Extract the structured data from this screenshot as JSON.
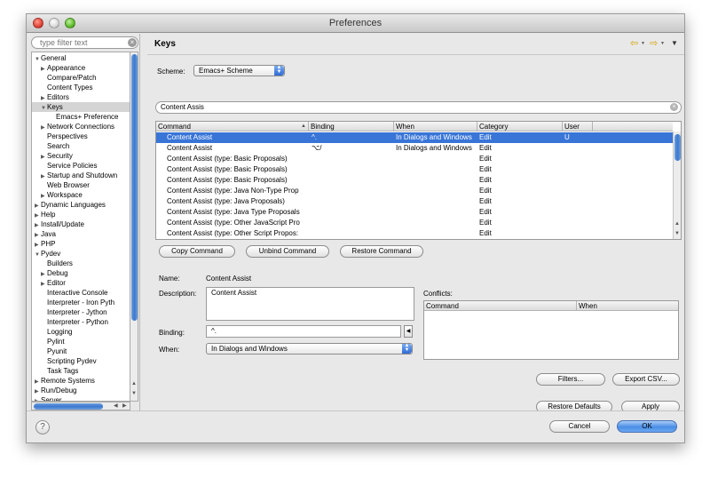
{
  "window": {
    "title": "Preferences"
  },
  "filter": {
    "placeholder": "type filter text"
  },
  "tree": [
    {
      "label": "General",
      "level": 0,
      "arrow": "open"
    },
    {
      "label": "Appearance",
      "level": 1,
      "arrow": "closed"
    },
    {
      "label": "Compare/Patch",
      "level": 1,
      "arrow": ""
    },
    {
      "label": "Content Types",
      "level": 1,
      "arrow": ""
    },
    {
      "label": "Editors",
      "level": 1,
      "arrow": "closed"
    },
    {
      "label": "Keys",
      "level": 1,
      "arrow": "open",
      "selected": true
    },
    {
      "label": "Emacs+ Preference",
      "level": 2,
      "arrow": ""
    },
    {
      "label": "Network Connections",
      "level": 1,
      "arrow": "closed"
    },
    {
      "label": "Perspectives",
      "level": 1,
      "arrow": ""
    },
    {
      "label": "Search",
      "level": 1,
      "arrow": ""
    },
    {
      "label": "Security",
      "level": 1,
      "arrow": "closed"
    },
    {
      "label": "Service Policies",
      "level": 1,
      "arrow": ""
    },
    {
      "label": "Startup and Shutdown",
      "level": 1,
      "arrow": "closed"
    },
    {
      "label": "Web Browser",
      "level": 1,
      "arrow": ""
    },
    {
      "label": "Workspace",
      "level": 1,
      "arrow": "closed"
    },
    {
      "label": "Dynamic Languages",
      "level": 0,
      "arrow": "closed"
    },
    {
      "label": "Help",
      "level": 0,
      "arrow": "closed"
    },
    {
      "label": "Install/Update",
      "level": 0,
      "arrow": "closed"
    },
    {
      "label": "Java",
      "level": 0,
      "arrow": "closed"
    },
    {
      "label": "PHP",
      "level": 0,
      "arrow": "closed"
    },
    {
      "label": "Pydev",
      "level": 0,
      "arrow": "open"
    },
    {
      "label": "Builders",
      "level": 1,
      "arrow": ""
    },
    {
      "label": "Debug",
      "level": 1,
      "arrow": "closed"
    },
    {
      "label": "Editor",
      "level": 1,
      "arrow": "closed"
    },
    {
      "label": "Interactive Console",
      "level": 1,
      "arrow": ""
    },
    {
      "label": "Interpreter - Iron Pyth",
      "level": 1,
      "arrow": ""
    },
    {
      "label": "Interpreter - Jython",
      "level": 1,
      "arrow": ""
    },
    {
      "label": "Interpreter - Python",
      "level": 1,
      "arrow": ""
    },
    {
      "label": "Logging",
      "level": 1,
      "arrow": ""
    },
    {
      "label": "Pylint",
      "level": 1,
      "arrow": ""
    },
    {
      "label": "Pyunit",
      "level": 1,
      "arrow": ""
    },
    {
      "label": "Scripting Pydev",
      "level": 1,
      "arrow": ""
    },
    {
      "label": "Task Tags",
      "level": 1,
      "arrow": ""
    },
    {
      "label": "Remote Systems",
      "level": 0,
      "arrow": "closed"
    },
    {
      "label": "Run/Debug",
      "level": 0,
      "arrow": "closed"
    },
    {
      "label": "Server",
      "level": 0,
      "arrow": "closed"
    }
  ],
  "page": {
    "title": "Keys",
    "nav_back": "⇦",
    "nav_fwd": "⇨",
    "menu": "▼"
  },
  "scheme": {
    "label": "Scheme:",
    "value": "Emacs+ Scheme"
  },
  "search": {
    "value": "Content Assis"
  },
  "table": {
    "headers": [
      "Command",
      "Binding",
      "When",
      "Category",
      "User"
    ],
    "rows": [
      [
        "Content Assist",
        "^.",
        "In Dialogs and Windows",
        "Edit",
        "U"
      ],
      [
        "Content Assist",
        "⌥/",
        "In Dialogs and Windows",
        "Edit",
        ""
      ],
      [
        "Content Assist (type: Basic Proposals)",
        "",
        "",
        "Edit",
        ""
      ],
      [
        "Content Assist (type: Basic Proposals)",
        "",
        "",
        "Edit",
        ""
      ],
      [
        "Content Assist (type: Basic Proposals)",
        "",
        "",
        "Edit",
        ""
      ],
      [
        "Content Assist (type: Java Non-Type Prop",
        "",
        "",
        "Edit",
        ""
      ],
      [
        "Content Assist (type: Java Proposals)",
        "",
        "",
        "Edit",
        ""
      ],
      [
        "Content Assist (type: Java Type Proposals",
        "",
        "",
        "Edit",
        ""
      ],
      [
        "Content Assist (type: Other JavaScript Pro",
        "",
        "",
        "Edit",
        ""
      ],
      [
        "Content Assist (type: Other Script Propos:",
        "",
        "",
        "Edit",
        ""
      ]
    ]
  },
  "buttons": {
    "copy": "Copy Command",
    "unbind": "Unbind Command",
    "restore": "Restore Command",
    "filters": "Filters...",
    "export": "Export CSV...",
    "restore_defaults": "Restore Defaults",
    "apply": "Apply",
    "cancel": "Cancel",
    "ok": "OK"
  },
  "details": {
    "name_label": "Name:",
    "name_value": "Content Assist",
    "desc_label": "Description:",
    "desc_value": "Content Assist",
    "binding_label": "Binding:",
    "binding_value": "^.",
    "when_label": "When:",
    "when_value": "In Dialogs and Windows"
  },
  "conflicts": {
    "label": "Conflicts:",
    "headers": [
      "Command",
      "When"
    ]
  },
  "colors": {
    "selection": "#3875d7",
    "accent": "#3b78d0"
  }
}
